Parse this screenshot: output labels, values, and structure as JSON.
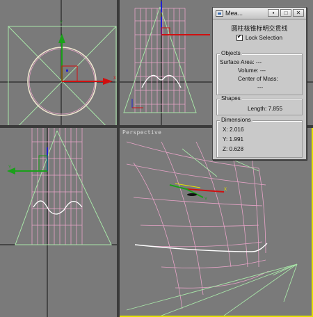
{
  "viewports": {
    "perspective_label": "Perspective"
  },
  "axes": {
    "x": "X",
    "y": "Y",
    "z": "Z"
  },
  "colors": {
    "viewport_bg": "#7a7a7a",
    "grid_line": "#000000",
    "wire_pink": "#e8a4c8",
    "wire_green": "#a8e6a8",
    "wire_white": "#ffffff",
    "axis_red": "#d01010",
    "axis_green": "#1aa01a",
    "axis_blue": "#2020d0",
    "active_border": "#e6e200"
  },
  "measure": {
    "window_title": "Mea...",
    "window_buttons": [
      "▪",
      "□",
      "✕"
    ],
    "object_name": "圆柱核锥标明交贯线",
    "lock_selection_label": "Lock Selection",
    "lock_selection_checked": true,
    "objects": {
      "legend": "Objects",
      "surface_area": "Surface Area: ---",
      "volume": "Volume: ---",
      "center_of_mass": "Center of Mass:",
      "center_value": "---"
    },
    "shapes": {
      "legend": "Shapes",
      "length": "Length: 7.855"
    },
    "dimensions": {
      "legend": "Dimensions",
      "x": "X:  2.016",
      "y": "Y:  1.991",
      "z": "Z:  0.628"
    }
  }
}
